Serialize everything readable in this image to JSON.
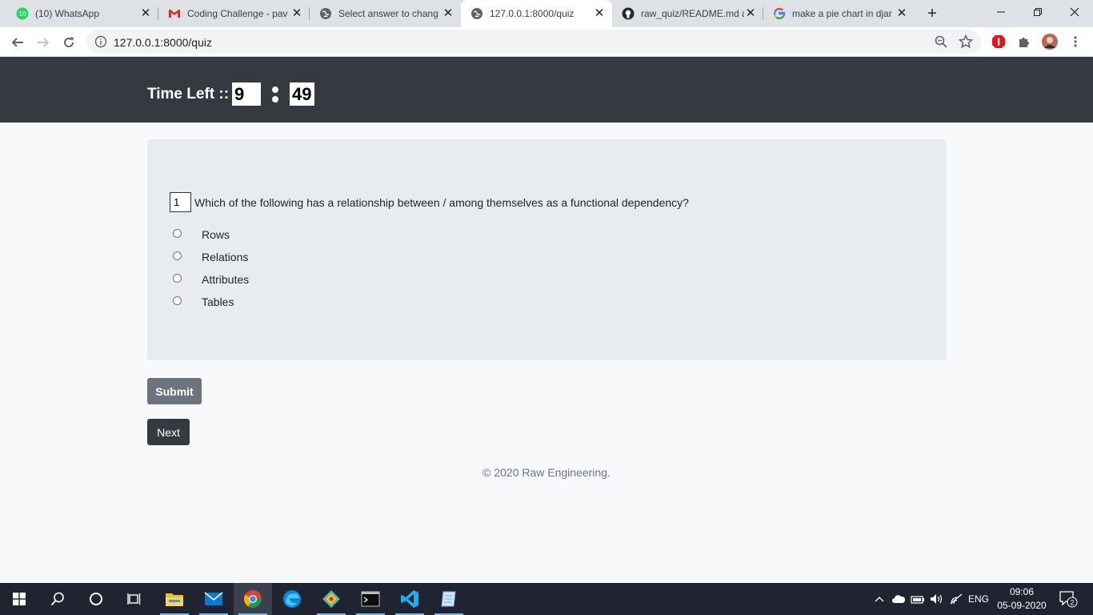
{
  "browser": {
    "tabs": [
      {
        "title": "(10) WhatsApp",
        "icon": "whatsapp-icon"
      },
      {
        "title": "Coding Challenge - pav",
        "icon": "gmail-icon"
      },
      {
        "title": "Select answer to chang",
        "icon": "globe-icon"
      },
      {
        "title": "127.0.0.1:8000/quiz",
        "icon": "globe-icon",
        "active": true
      },
      {
        "title": "raw_quiz/README.md a",
        "icon": "github-icon"
      },
      {
        "title": "make a pie chart in djar",
        "icon": "google-icon"
      }
    ],
    "whatsapp_badge": "10",
    "url": "127.0.0.1:8000/quiz"
  },
  "quiz": {
    "timer": {
      "label": "Time Left ::",
      "minutes": "9",
      "seconds": "49"
    },
    "question": {
      "number": "1",
      "text": "Which of the following has a relationship between / among themselves as a functional dependency?"
    },
    "options": [
      "Rows",
      "Relations",
      "Attributes",
      "Tables"
    ],
    "submit_label": "Submit",
    "next_label": "Next",
    "footer": "© 2020 Raw Engineering."
  },
  "taskbar": {
    "language": "ENG",
    "time": "09:06",
    "date": "05-09-2020",
    "notification_count": "2"
  },
  "colors": {
    "navbar": "#343a40",
    "page_bg": "#f8f9fa",
    "card_bg": "#e9ecef",
    "submit_btn": "#6c757d",
    "next_btn": "#343a40"
  }
}
